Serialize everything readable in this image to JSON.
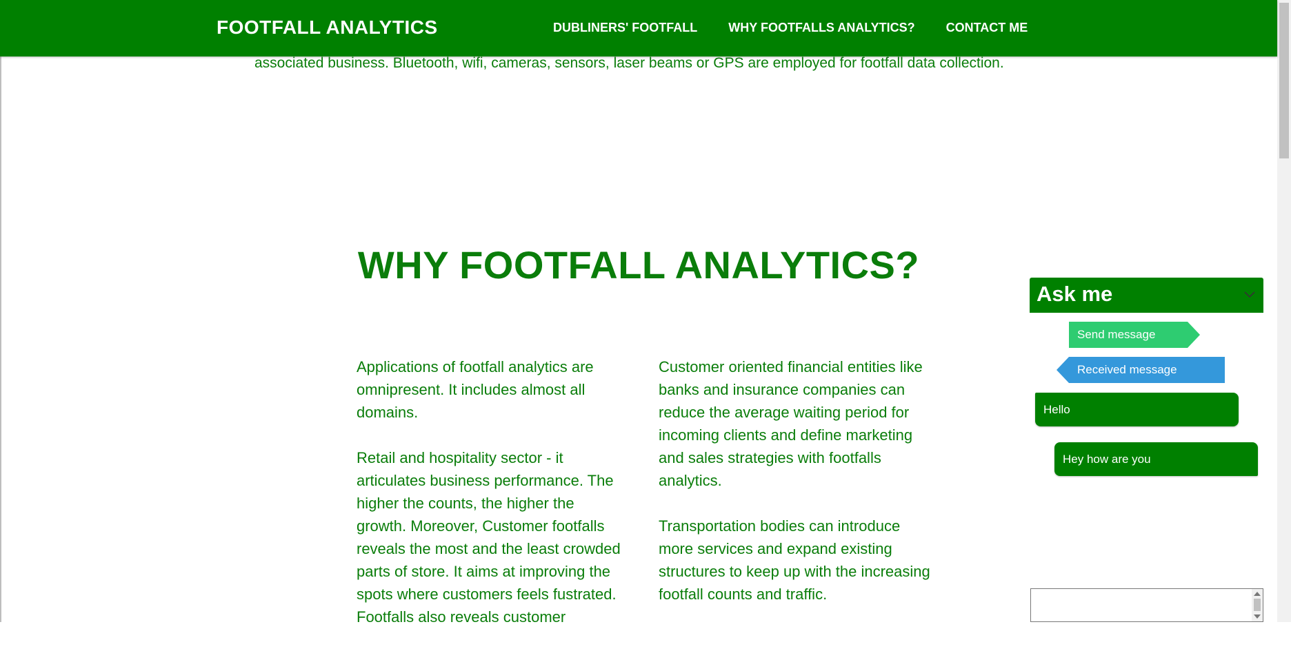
{
  "navbar": {
    "brand": "FOOTFALL ANALYTICS",
    "links": [
      {
        "label": "DUBLINERS' FOOTFALL"
      },
      {
        "label": "WHY FOOTFALLS ANALYTICS?"
      },
      {
        "label": "CONTACT ME"
      }
    ]
  },
  "intro": {
    "tail": "associated business. Bluetooth, wifi, cameras, sensors, laser beams or GPS are employed for footfall data collection."
  },
  "why_section": {
    "heading": "WHY FOOTFALL ANALYTICS?",
    "left_column": [
      "Applications of footfall analytics are omnipresent. It includes almost all domains.",
      "Retail and hospitality sector - it articulates business performance. The higher the counts, the higher the growth. Moreover, Customer footfalls reveals the most and the least crowded parts of store. It aims at improving the spots where customers feels fustrated. Footfalls also reveals customer"
    ],
    "right_column": [
      "Customer oriented financial entities like banks and insurance companies can reduce the average waiting period for incoming clients and define marketing and sales strategies with footfalls analytics.",
      "Transportation bodies can introduce more services and expand existing structures to keep up with the increasing footfall counts and traffic."
    ]
  },
  "chat": {
    "title": "Ask me",
    "toggle_icon": "chevron-down-icon",
    "legend_send": "Send message",
    "legend_received": "Received message",
    "messages": [
      {
        "text": "Hello"
      },
      {
        "text": "Hey how are you"
      }
    ],
    "colors": {
      "header": "#008000",
      "send": "#2ecc71",
      "received": "#3498db",
      "message": "#008000"
    }
  },
  "theme": {
    "primary": "#008000",
    "text": "#0a7d0a"
  }
}
